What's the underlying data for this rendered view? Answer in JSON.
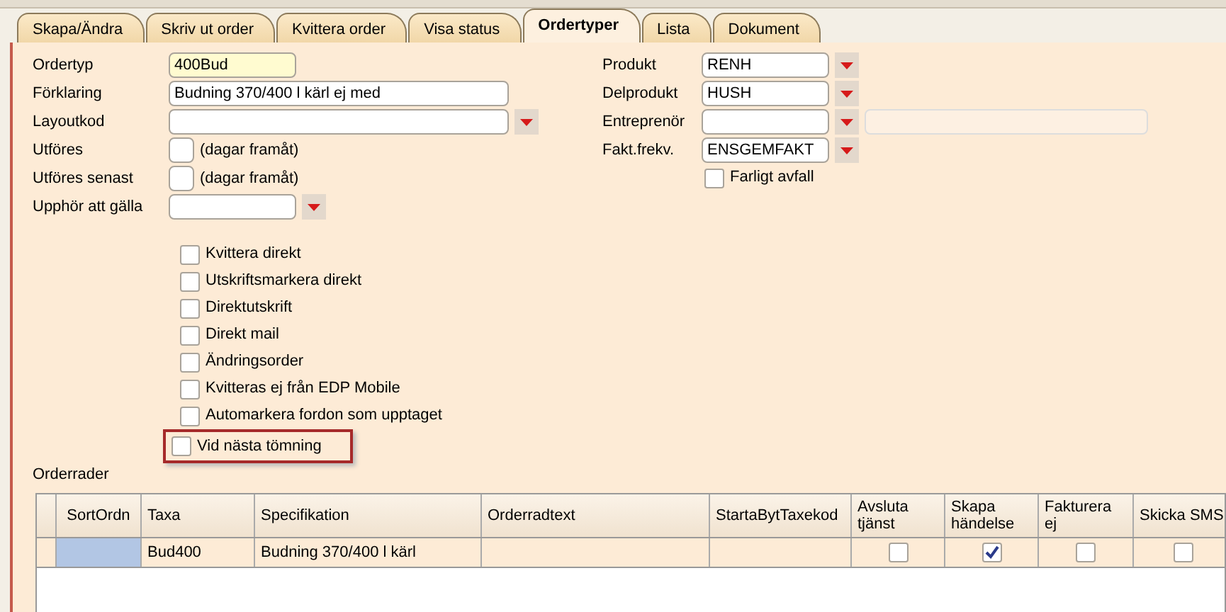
{
  "tabs": [
    {
      "label": "Skapa/Ändra",
      "selected": false
    },
    {
      "label": "Skriv ut order",
      "selected": false
    },
    {
      "label": "Kvittera order",
      "selected": false
    },
    {
      "label": "Visa status",
      "selected": false
    },
    {
      "label": "Ordertyper",
      "selected": true
    },
    {
      "label": "Lista",
      "selected": false
    },
    {
      "label": "Dokument",
      "selected": false
    }
  ],
  "left_fields": [
    {
      "label": "Ordertyp",
      "kind": "short",
      "value": "400Bud",
      "focused": true
    },
    {
      "label": "Förklaring",
      "kind": "text",
      "value": "Budning 370/400 l kärl ej med",
      "focused": false
    },
    {
      "label": "Layoutkod",
      "kind": "combo",
      "focused": false
    },
    {
      "label": "Utföres",
      "kind": "days",
      "suffix": "(dagar framåt)",
      "focused": false
    },
    {
      "label": "Utföres senast",
      "kind": "days",
      "suffix": "(dagar framåt)",
      "focused": false
    },
    {
      "label": "Upphör att gälla",
      "kind": "short-combo",
      "focused": false
    }
  ],
  "right_fields": [
    {
      "label": "Produkt",
      "kind": "combo",
      "value": "RENH"
    },
    {
      "label": "Delprodukt",
      "kind": "combo",
      "value": "HUSH"
    },
    {
      "label": "Entreprenör",
      "kind": "combo-extra"
    },
    {
      "label": "Fakt.frekv.",
      "kind": "combo",
      "value": "ENSGEMFAKT"
    }
  ],
  "farligt_avfall": {
    "label": "Farligt avfall",
    "checked": false
  },
  "options": [
    {
      "label": "Kvittera direkt",
      "checked": false,
      "highlighted": false
    },
    {
      "label": "Utskriftsmarkera direkt",
      "checked": false,
      "highlighted": false
    },
    {
      "label": "Direktutskrift",
      "checked": false,
      "highlighted": false
    },
    {
      "label": "Direkt mail",
      "checked": false,
      "highlighted": false
    },
    {
      "label": "Ändringsorder",
      "checked": false,
      "highlighted": false
    },
    {
      "label": "Kvitteras ej från EDP Mobile",
      "checked": false,
      "highlighted": false
    },
    {
      "label": "Automarkera fordon som upptaget",
      "checked": false,
      "highlighted": false
    },
    {
      "label": "Vid nästa tömning",
      "checked": false,
      "highlighted": true
    }
  ],
  "orderrader": {
    "title": "Orderrader",
    "columns": [
      "SortOrdn",
      "Taxa",
      "Specifikation",
      "Orderradtext",
      "StartaBytTaxekod",
      "Avsluta tjänst",
      "Skapa händelse",
      "Fakturera ej",
      "Skicka SMS"
    ],
    "rows": [
      {
        "cells": [
          {
            "kind": "text",
            "selected": true
          },
          {
            "kind": "text",
            "value": "Bud400"
          },
          {
            "kind": "text",
            "value": "Budning 370/400 l kärl"
          },
          {
            "kind": "text"
          },
          {
            "kind": "text"
          },
          {
            "kind": "check",
            "checked": false
          },
          {
            "kind": "check",
            "checked": true
          },
          {
            "kind": "check",
            "checked": false
          },
          {
            "kind": "check",
            "checked": false
          }
        ]
      }
    ]
  }
}
